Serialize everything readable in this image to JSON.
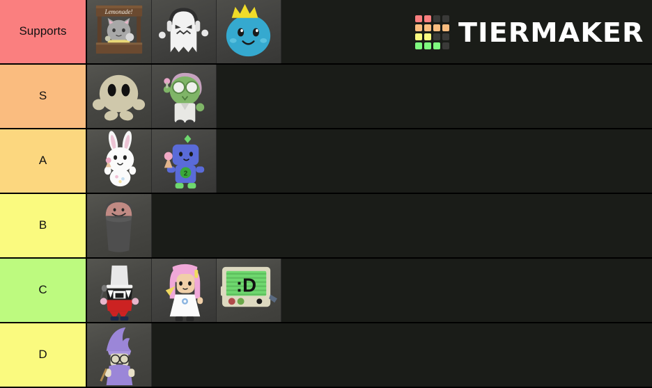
{
  "app": {
    "brand_name": "TIERMAKER",
    "background_color": "#1a1c18",
    "divider_color": "#000000"
  },
  "logo": {
    "name": "tiermaker-logo",
    "text": "TIERMAKER",
    "grid_colors": [
      [
        "#fa7f7f",
        "#fa7f7f",
        "#3a3a38",
        "#3a3a38"
      ],
      [
        "#fabc7f",
        "#fabc7f",
        "#fabc7f",
        "#fabc7f"
      ],
      [
        "#fafa7f",
        "#fafa7f",
        "#3a3a38",
        "#3a3a38"
      ],
      [
        "#7ffa7f",
        "#7ffa7f",
        "#7ffa7f",
        "#3a3a38"
      ]
    ]
  },
  "tiers": [
    {
      "label": "Supports",
      "color": "#fa7f7f",
      "items": [
        {
          "name": "lemonade-stand-cat",
          "caption": "Lemonade!"
        },
        {
          "name": "ghost-with-headphones",
          "caption": ""
        },
        {
          "name": "blueberry-king",
          "caption": ""
        }
      ]
    },
    {
      "label": "S",
      "color": "#fabc7f",
      "items": [
        {
          "name": "beige-ghost-blob",
          "caption": ""
        },
        {
          "name": "green-zombie-doctor",
          "caption": ""
        }
      ]
    },
    {
      "label": "A",
      "color": "#fcd77f",
      "items": [
        {
          "name": "white-bunny-with-ice-cream",
          "caption": ""
        },
        {
          "name": "blue-robot-kid",
          "caption": ""
        }
      ]
    },
    {
      "label": "B",
      "color": "#fafa7f",
      "items": [
        {
          "name": "trash-can-creature",
          "caption": ""
        }
      ]
    },
    {
      "label": "C",
      "color": "#bdfa7f",
      "items": [
        {
          "name": "top-hat-magician",
          "caption": ""
        },
        {
          "name": "pink-haired-girl",
          "caption": ""
        },
        {
          "name": "smiley-computer-monitor",
          "caption": ":D"
        }
      ]
    },
    {
      "label": "D",
      "color": "#fafa7f",
      "items": [
        {
          "name": "purple-wizard",
          "caption": ""
        }
      ]
    }
  ]
}
